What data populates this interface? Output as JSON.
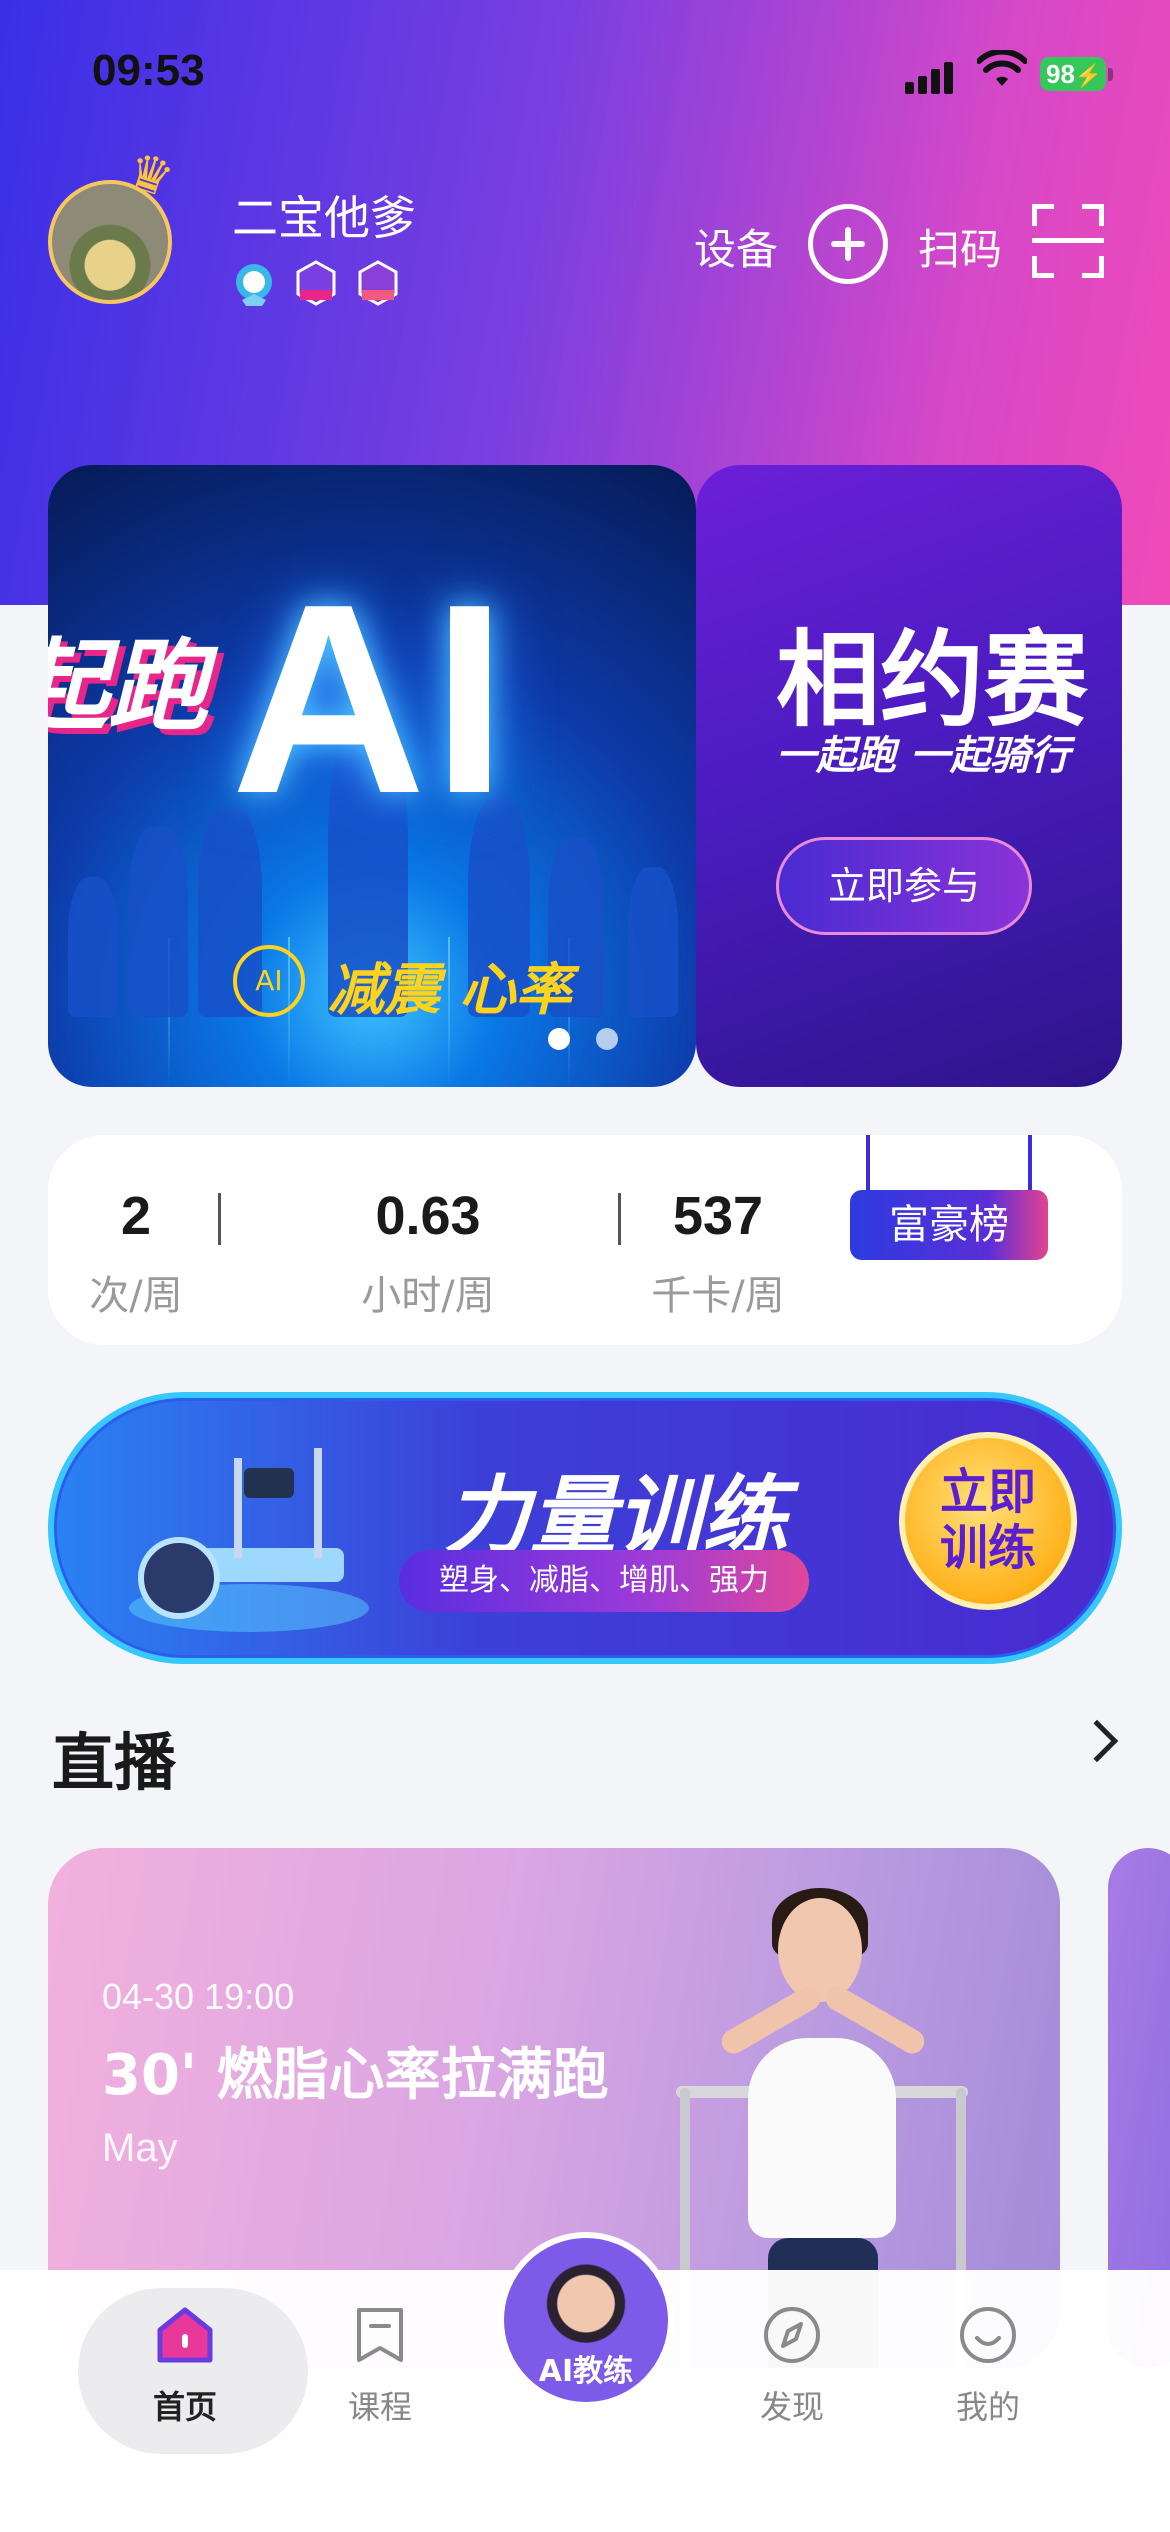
{
  "status_bar": {
    "time": "09:53",
    "battery": "98"
  },
  "profile": {
    "username": "二宝他爹",
    "badges": [
      "running-badge",
      "365km-badge",
      "100km-badge"
    ]
  },
  "header": {
    "device_label": "设备",
    "scan_label": "扫码"
  },
  "banners": [
    {
      "left_text": "起跑",
      "big_text": "AI",
      "tag_ring": "AI",
      "tag_text": "减震 心率"
    },
    {
      "title": "相约赛",
      "subtitle": "一起跑 一起骑行",
      "button": "立即参与"
    }
  ],
  "stats": [
    {
      "value": "2",
      "unit": "次/周"
    },
    {
      "value": "0.63",
      "unit": "小时/周"
    },
    {
      "value": "537",
      "unit": "千卡/周"
    }
  ],
  "rich_list_label": "富豪榜",
  "strength": {
    "title": "力量训练",
    "tags": "塑身、减脂、增肌、强力",
    "button_line1": "立即",
    "button_line2": "训练"
  },
  "live": {
    "section_title": "直播",
    "card": {
      "datetime": "04-30 19:00",
      "title": "30' 燃脂心率拉满跑",
      "coach": "May"
    }
  },
  "tabbar": {
    "home": "首页",
    "courses": "课程",
    "ai_coach": "AI教练",
    "discover": "发现",
    "mine": "我的"
  },
  "colors": {
    "accent": "#5b2ed8",
    "brand_pink": "#e8268a",
    "gold": "#ffd21c"
  }
}
